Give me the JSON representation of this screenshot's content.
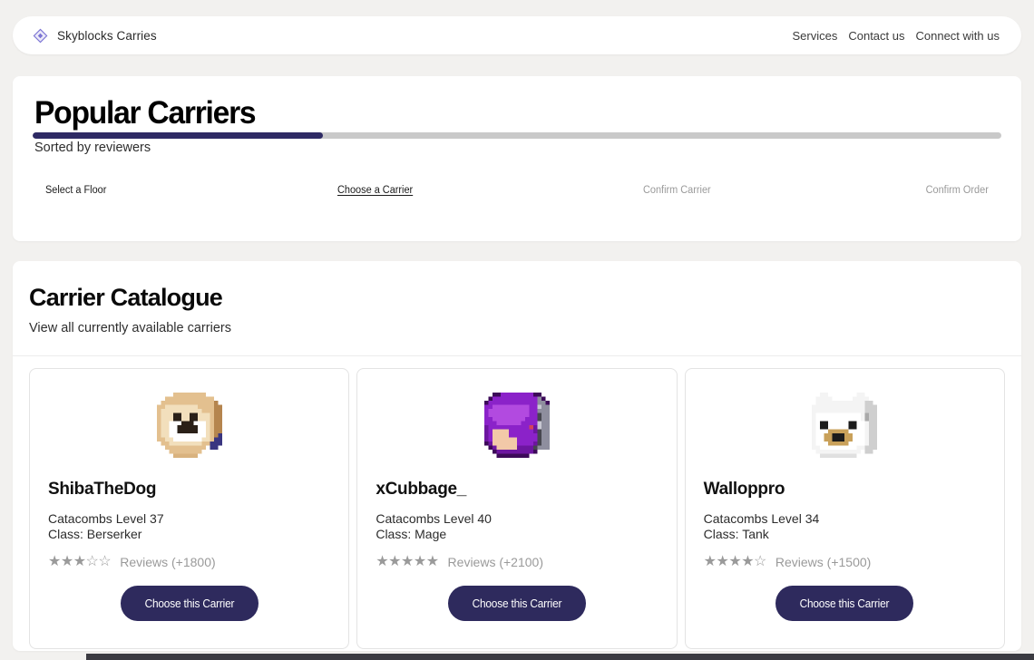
{
  "header": {
    "logo_icon": "diamond-sparkle-icon",
    "brand": "Skyblocks Carries",
    "nav": [
      {
        "label": "Services"
      },
      {
        "label": "Contact us"
      },
      {
        "label": "Connect with us"
      }
    ]
  },
  "popular": {
    "title": "Popular Carriers",
    "subtitle": "Sorted by reviewers",
    "steps": [
      {
        "label": "Select a Floor",
        "state": "done"
      },
      {
        "label": "Choose a Carrier",
        "state": "active"
      },
      {
        "label": "Confirm Carrier",
        "state": "upcoming"
      },
      {
        "label": "Confirm Order",
        "state": "upcoming"
      }
    ],
    "progress_percent": 30,
    "progress_fill_color": "#2e2a64",
    "progress_track_color": "#c9c9c9"
  },
  "catalogue": {
    "title": "Carrier Catalogue",
    "subtitle": "View all currently available carriers",
    "cards": [
      {
        "avatar_icon": "shiba-head-avatar",
        "name": "ShibaTheDog",
        "level": "Catacombs Level 37",
        "class": "Class: Berserker",
        "stars_filled": 3,
        "stars_total": 5,
        "reviews": "Reviews (+1800)",
        "button_label": "Choose this Carrier"
      },
      {
        "avatar_icon": "purple-hair-avatar",
        "name": "xCubbage_",
        "level": "Catacombs Level 40",
        "class": "Class: Mage",
        "stars_filled": 5,
        "stars_total": 5,
        "reviews": "Reviews (+2100)",
        "button_label": "Choose this Carrier"
      },
      {
        "avatar_icon": "polar-bear-avatar",
        "name": "Walloppro",
        "level": "Catacombs Level 34",
        "class": "Class: Tank",
        "stars_filled": 4,
        "stars_total": 5,
        "reviews": "Reviews (+1500)",
        "button_label": "Choose this Carrier"
      }
    ]
  },
  "theme": {
    "page_background": "#f2f1ef",
    "accent": "#2e2a5d",
    "logo_color": "#7b74d4"
  }
}
